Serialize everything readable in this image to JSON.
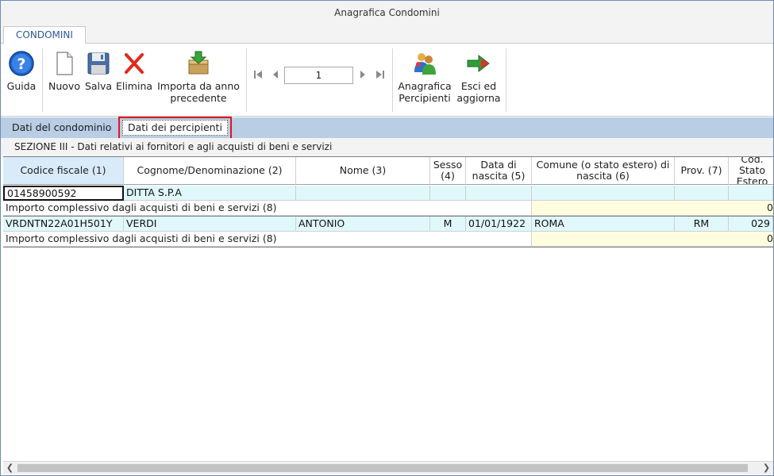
{
  "window": {
    "title": "Anagrafica Condomini"
  },
  "ribbon": {
    "tab": "CONDOMINI",
    "buttons": {
      "help": "Guida",
      "new": "Nuovo",
      "save": "Salva",
      "delete": "Elimina",
      "import_line1": "Importa da anno",
      "import_line2": "precedente",
      "percipienti_line1": "Anagrafica",
      "percipienti_line2": "Percipienti",
      "exit_line1": "Esci ed",
      "exit_line2": "aggiorna"
    },
    "pager": {
      "current_page": "1"
    },
    "icons": [
      "help-icon",
      "new-document-icon",
      "save-icon",
      "delete-icon",
      "import-icon",
      "first-icon",
      "prev-icon",
      "next-icon",
      "last-icon",
      "people-icon",
      "exit-arrow-icon"
    ]
  },
  "subtabs": [
    "Dati del condominio",
    "Dati dei percipienti"
  ],
  "section_title": "SEZIONE III - Dati relativi ai fornitori e agli acquisti di beni e servizi",
  "grid": {
    "headers": [
      "Codice fiscale (1)",
      "Cognome/Denominazione (2)",
      "Nome (3)",
      "Sesso (4)",
      "Data di nascita (5)",
      "Comune (o stato estero) di nascita (6)",
      "Prov. (7)",
      "Cod. Stato Estero"
    ],
    "rows": [
      {
        "codice_fiscale": "01458900592",
        "cognome": "DITTA S.P.A",
        "nome": "",
        "sesso": "",
        "data_nascita": "",
        "comune": "",
        "prov": "",
        "cod_stato": "",
        "total_label": "Importo complessivo dagli acquisti di beni e servizi (8)",
        "total_value": "0"
      },
      {
        "codice_fiscale": "VRDNTN22A01H501Y",
        "cognome": "VERDI",
        "nome": "ANTONIO",
        "sesso": "M",
        "data_nascita": "01/01/1922",
        "comune": "ROMA",
        "prov": "RM",
        "cod_stato": "029",
        "total_label": "Importo complessivo dagli acquisti di beni e servizi (8)",
        "total_value": "0"
      }
    ]
  },
  "colors": {
    "accent": "#2b579a",
    "subtab_bar": "#b9cde4",
    "row_cyan": "#e0f8fb",
    "total_yellow": "#fffde0",
    "highlight": "#e0141e"
  }
}
